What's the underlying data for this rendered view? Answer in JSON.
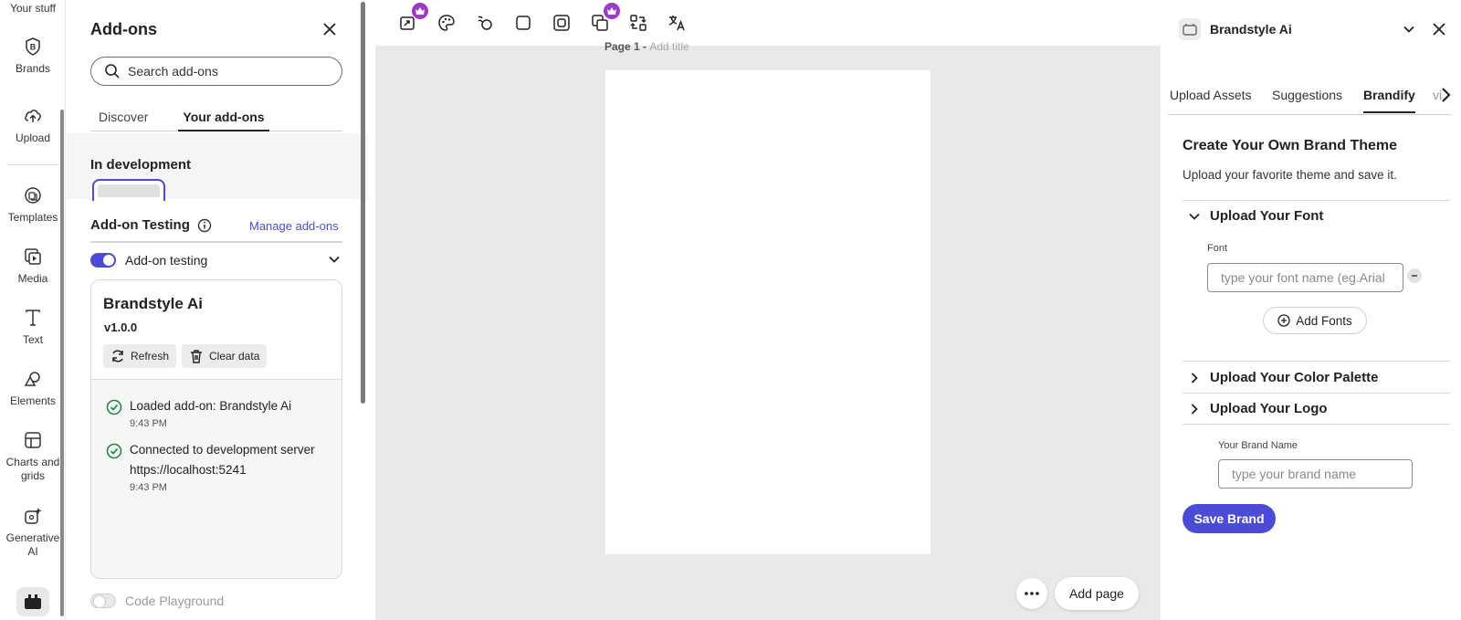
{
  "rail": {
    "top_label": "Your stuff",
    "items": [
      {
        "label": "Brands",
        "icon": "brand-icon"
      },
      {
        "label": "Upload",
        "icon": "cloud-upload-icon"
      },
      {
        "label": "Templates",
        "icon": "templates-icon"
      },
      {
        "label": "Media",
        "icon": "media-icon"
      },
      {
        "label": "Text",
        "icon": "text-icon"
      },
      {
        "label": "Elements",
        "icon": "elements-icon"
      },
      {
        "label": "Charts and grids",
        "icon": "charts-icon"
      },
      {
        "label": "Generative AI",
        "icon": "generative-ai-icon"
      }
    ]
  },
  "addons": {
    "title": "Add-ons",
    "search_placeholder": "Search add-ons",
    "tabs": [
      "Discover",
      "Your add-ons"
    ],
    "active_tab": "Your add-ons",
    "dev_title": "In development",
    "testing_title": "Add-on Testing",
    "manage_link": "Manage add-ons",
    "toggle_label": "Add-on testing",
    "card": {
      "name": "Brandstyle Ai",
      "version": "v1.0.0",
      "refresh": "Refresh",
      "clear": "Clear data",
      "logs": [
        {
          "line1": "Loaded add-on: Brandstyle Ai",
          "line2": "",
          "time": "9:43 PM"
        },
        {
          "line1": "Connected to development server",
          "line2": "https://localhost:5241",
          "time": "9:43 PM"
        }
      ]
    },
    "code_playground": "Code Playground"
  },
  "canvas": {
    "page_label": "Page 1 - ",
    "page_title_placeholder": "Add title",
    "add_page": "Add page"
  },
  "brandstyle": {
    "title": "Brandstyle Ai",
    "tabs": [
      "Upload Assets",
      "Suggestions",
      "Brandify",
      "vi"
    ],
    "active_tab": "Brandify",
    "heading": "Create Your Own Brand Theme",
    "subheading": "Upload your favorite theme and save it.",
    "font_section": "Upload Your Font",
    "font_label": "Font",
    "font_placeholder": "type your font name (eg.Arial",
    "add_fonts": "Add Fonts",
    "color_section": "Upload Your Color Palette",
    "logo_section": "Upload Your Logo",
    "brand_name_label": "Your Brand Name",
    "brand_name_placeholder": "type your brand name",
    "save": "Save Brand"
  },
  "colors": {
    "accent": "#4b4bd8",
    "premium_badge": "#9b3cc8",
    "success": "#1e8a4c"
  }
}
